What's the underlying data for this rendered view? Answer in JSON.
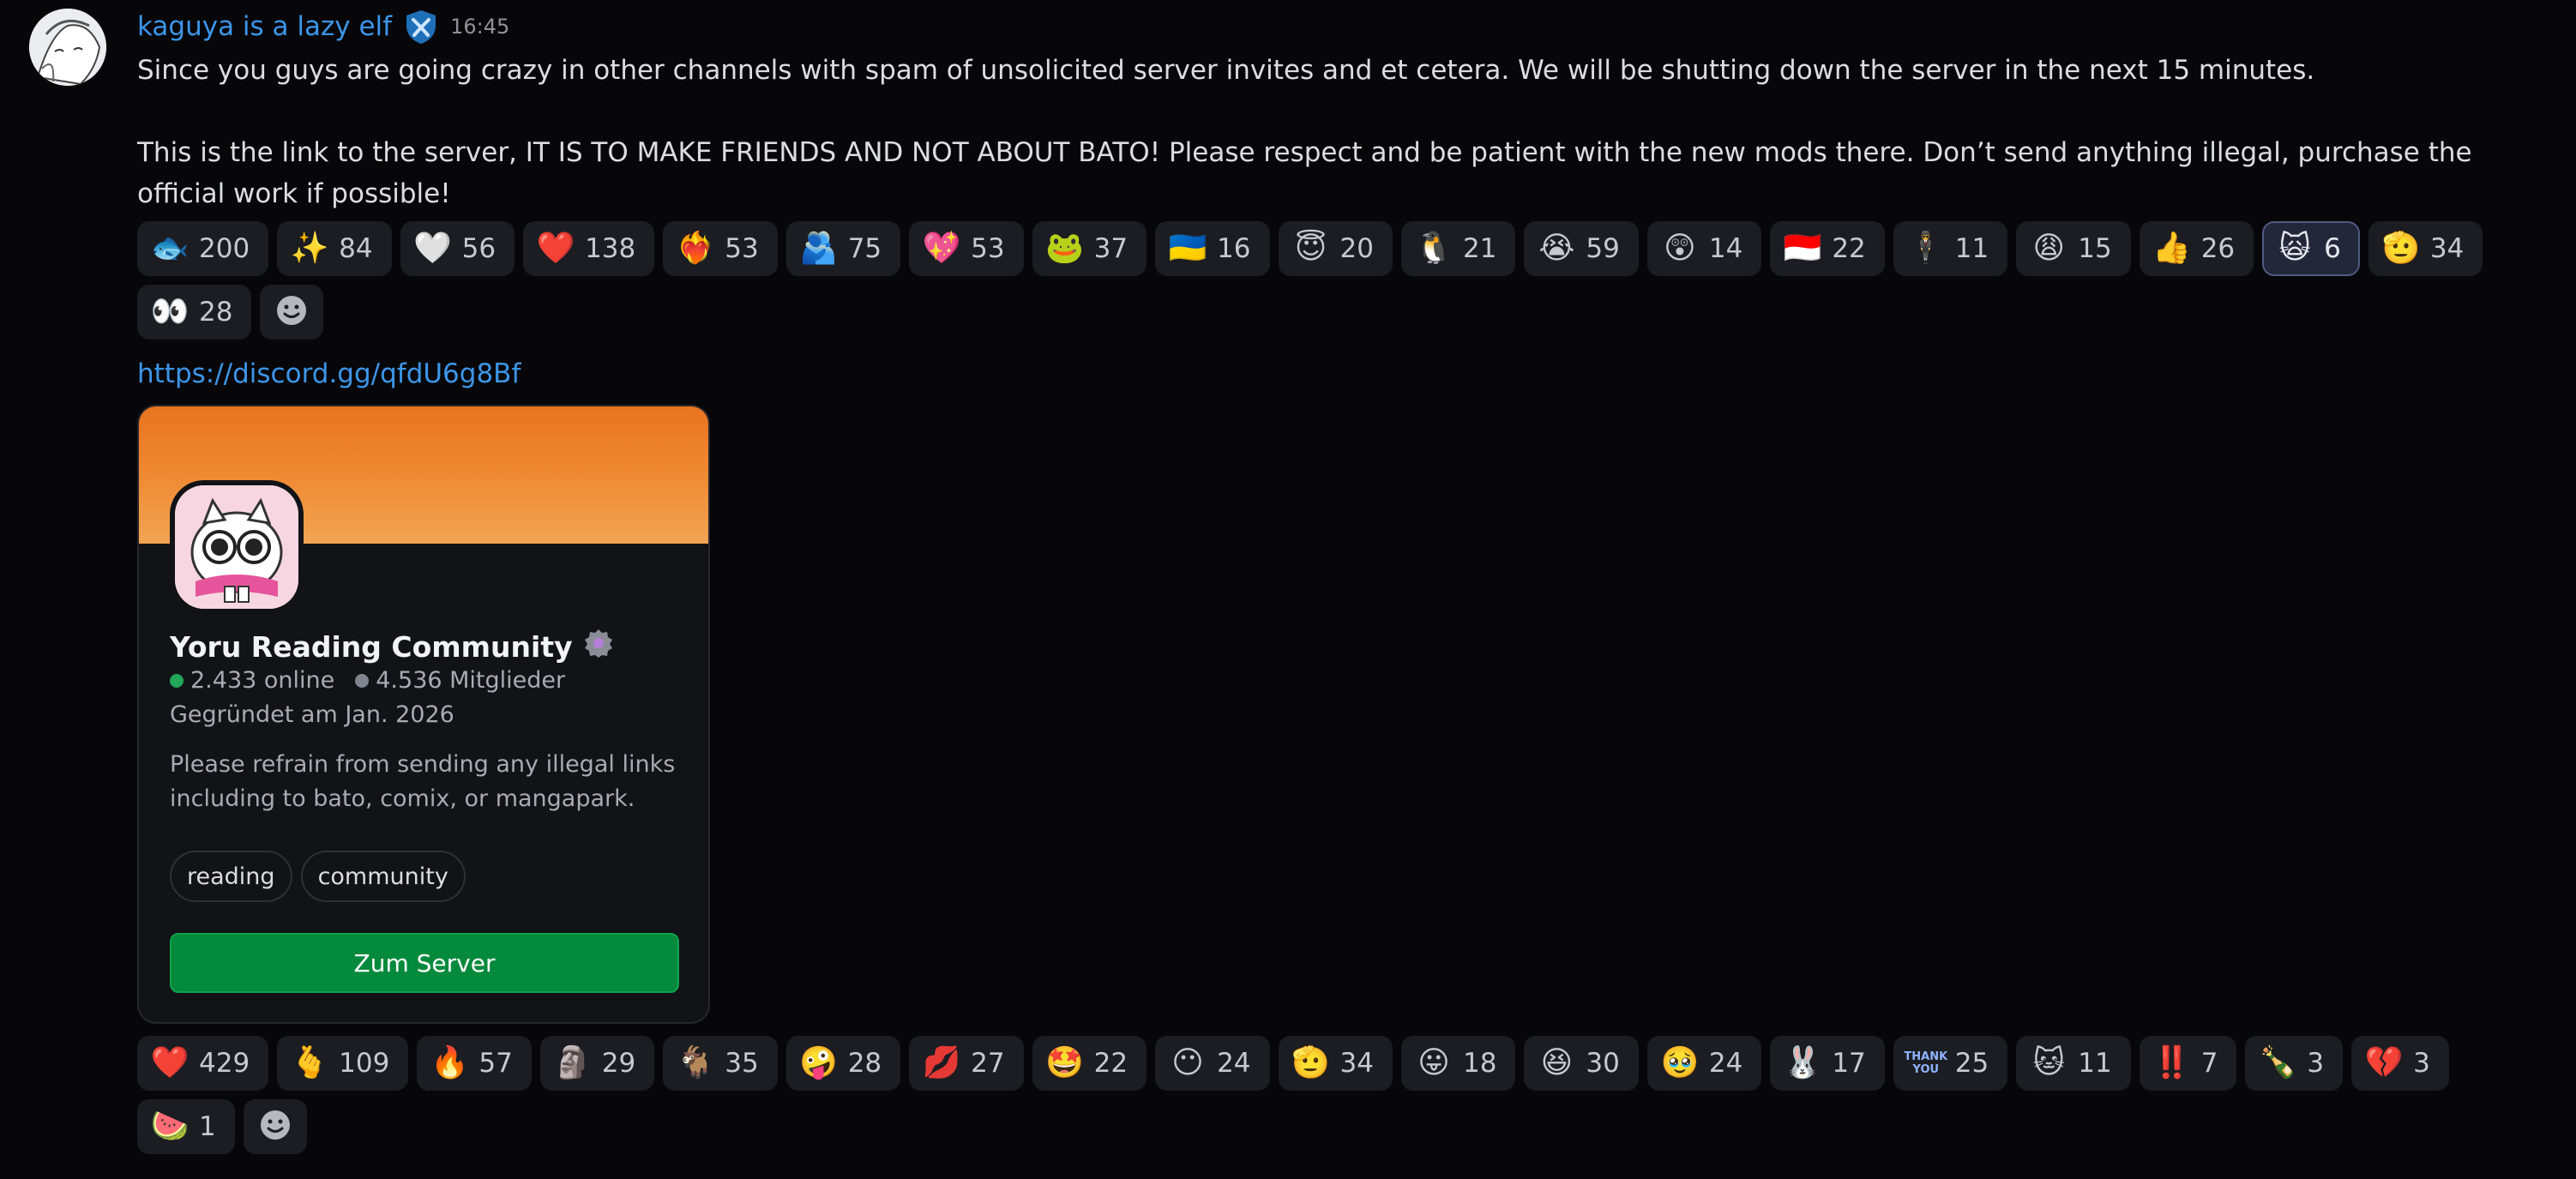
{
  "message": {
    "username": "kaguya is a lazy elf",
    "timestamp": "16:45",
    "badge_icon": "hammer-shield-icon",
    "line1": "Since you guys are going crazy in other channels with spam of unsolicited server invites and et cetera. We will be shutting down the server in the next 15 minutes.",
    "line2": "This is the link to the server, IT IS TO MAKE FRIENDS AND NOT ABOUT BATO! Please respect and be patient with the new mods there. Don’t send anything illegal, purchase the official work if possible!",
    "link": "https://discord.gg/qfdU6g8Bf"
  },
  "reactions_top": [
    {
      "emoji": "🐟",
      "count": "200"
    },
    {
      "emoji": "✨",
      "count": "84"
    },
    {
      "emoji": "🤍",
      "count": "56"
    },
    {
      "emoji": "❤️",
      "count": "138"
    },
    {
      "emoji": "❤️‍🔥",
      "count": "53"
    },
    {
      "emoji": "🫂",
      "count": "75"
    },
    {
      "emoji": "💖",
      "count": "53"
    },
    {
      "emoji": "🐸",
      "count": "37"
    },
    {
      "emoji": "🇺🇦",
      "count": "16"
    },
    {
      "emoji": "😇",
      "count": "20"
    },
    {
      "emoji": "🐧",
      "count": "21"
    },
    {
      "emoji": "😭",
      "count": "59"
    },
    {
      "emoji": "😲",
      "count": "14"
    },
    {
      "emoji": "🇮🇩",
      "count": "22"
    },
    {
      "emoji": "🕴️",
      "count": "11"
    },
    {
      "emoji": "😩",
      "count": "15"
    },
    {
      "emoji": "👍",
      "count": "26"
    },
    {
      "emoji": "🙀",
      "count": "6",
      "me": true
    },
    {
      "emoji": "🫡",
      "count": "34"
    },
    {
      "emoji": "👀",
      "count": "28"
    }
  ],
  "reactions_bottom": [
    {
      "emoji": "❤️",
      "count": "429"
    },
    {
      "emoji": "🫰",
      "count": "109"
    },
    {
      "emoji": "🔥",
      "count": "57"
    },
    {
      "emoji": "🗿",
      "count": "29"
    },
    {
      "emoji": "🐐",
      "count": "35"
    },
    {
      "emoji": "🤪",
      "count": "28"
    },
    {
      "emoji": "💋",
      "count": "27"
    },
    {
      "emoji": "🤩",
      "count": "22"
    },
    {
      "emoji": "😶",
      "count": "24"
    },
    {
      "emoji": "🫡",
      "count": "34"
    },
    {
      "emoji": "😛",
      "count": "18"
    },
    {
      "emoji": "😆",
      "count": "30"
    },
    {
      "emoji": "🥹",
      "count": "24"
    },
    {
      "emoji": "🐰",
      "count": "17"
    },
    {
      "emoji": "THANK YOU",
      "count": "25",
      "text_emoji": true
    },
    {
      "emoji": "🐱",
      "count": "11"
    },
    {
      "emoji": "‼️",
      "count": "7"
    },
    {
      "emoji": "🍾",
      "count": "3"
    },
    {
      "emoji": "💔",
      "count": "3"
    },
    {
      "emoji": "🍉",
      "count": "1"
    }
  ],
  "invite": {
    "server_name": "Yoru Reading Community",
    "online": "2.433 online",
    "members": "4.536 Mitglieder",
    "founded": "Gegründet am Jan. 2026",
    "description": "Please refrain from sending any illegal links including to bato, comix, or mangapark.",
    "tags": [
      "reading",
      "community"
    ],
    "button": "Zum Server",
    "online_color": "#23a55a",
    "members_color": "#80848e"
  },
  "colors": {
    "accent_link": "#3d95e8",
    "button_green": "#048a3c"
  }
}
